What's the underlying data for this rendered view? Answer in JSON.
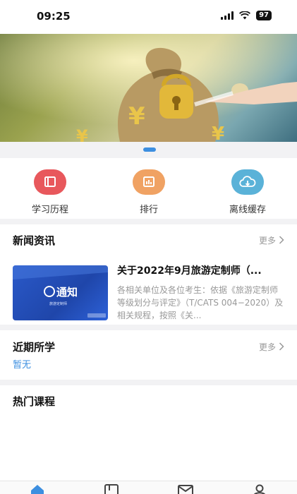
{
  "status": {
    "time": "09:25",
    "battery": "97"
  },
  "quick": [
    {
      "label": "学习历程",
      "icon": "book-icon",
      "color": "#e8585c"
    },
    {
      "label": "排行",
      "icon": "ranking-icon",
      "color": "#f0a263"
    },
    {
      "label": "离线缓存",
      "icon": "cloud-download-icon",
      "color": "#5ab2d8"
    }
  ],
  "news": {
    "title": "新闻资讯",
    "more": "更多",
    "item": {
      "thumb_text": "通知",
      "thumb_sub": "旅游定制师",
      "headline": "关于2022年9月旅游定制师（...",
      "desc": "各相关单位及各位考生：依据《旅游定制师等级划分与评定》（T/CATS 004−2020）及相关规程，按照《关..."
    }
  },
  "recent": {
    "title": "近期所学",
    "more": "更多",
    "empty": "暂无"
  },
  "hot": {
    "title": "热门课程"
  },
  "tabs": [
    "home-icon",
    "courses-icon",
    "message-icon",
    "profile-icon"
  ],
  "colors": {
    "accent": "#3d8fe0"
  }
}
